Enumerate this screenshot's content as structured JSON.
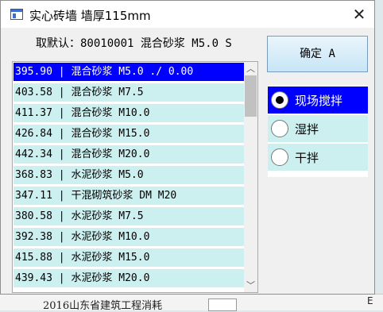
{
  "window": {
    "title": "实心砖墙 墙厚115mm",
    "close_glyph": "✕"
  },
  "default_label": "取默认：80010001 混合砂浆 M5.0 S",
  "list": {
    "selected_index": 0,
    "items": [
      "395.90 | 混合砂浆 M5.0  ./ 0.00",
      "403.58 | 混合砂浆 M7.5",
      "411.37 | 混合砂浆 M10.0",
      "426.84 | 混合砂浆 M15.0",
      "442.34 | 混合砂浆 M20.0",
      "368.83 | 水泥砂浆 M5.0",
      "347.11 | 干混砌筑砂浆 DM M20",
      "380.58 | 水泥砂浆 M7.5",
      "392.38 | 水泥砂浆 M10.0",
      "415.88 | 水泥砂浆 M15.0",
      "439.43 | 水泥砂浆 M20.0"
    ],
    "scroll_up_glyph": "︿",
    "scroll_down_glyph": "﹀"
  },
  "confirm_button": "确定 A",
  "radios": {
    "selected_index": 0,
    "options": [
      "现场搅拌",
      "湿拌",
      "干拌"
    ]
  },
  "background": {
    "bottom_text": "2016山东省建筑工程消耗",
    "corner_text": "E"
  },
  "colors": {
    "selection": "#0000ff",
    "row_bg": "#ccefef"
  }
}
